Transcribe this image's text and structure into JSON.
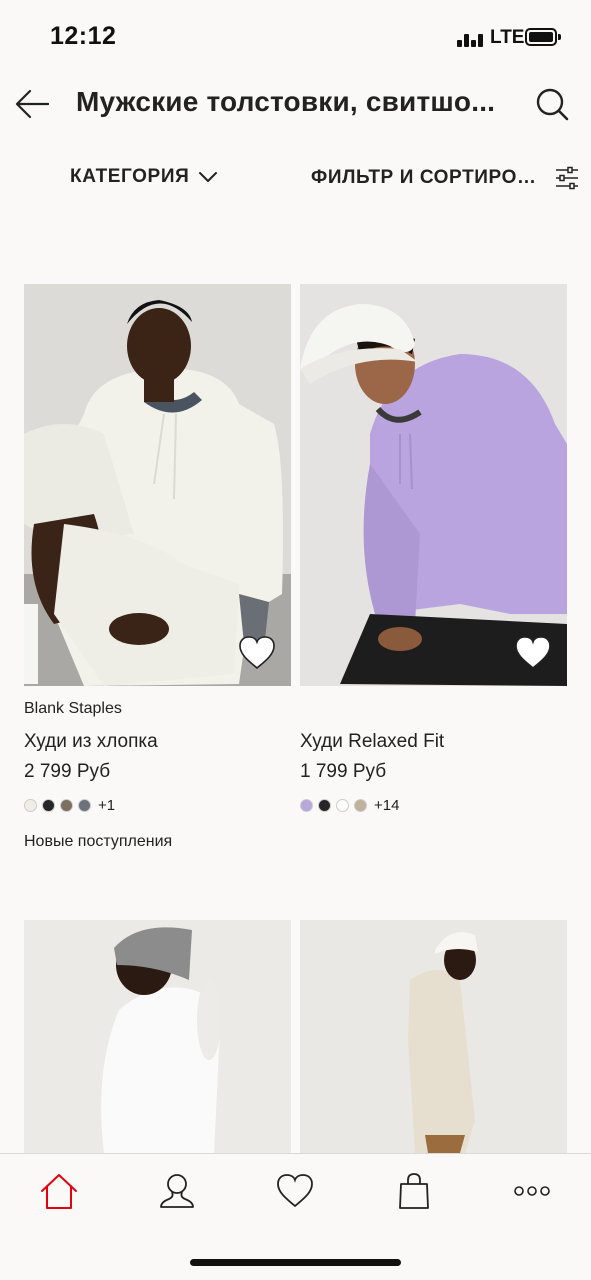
{
  "status_bar": {
    "time": "12:12",
    "carrier": "LTE"
  },
  "header": {
    "title": "Мужские толстовки, свитшо...",
    "back_icon": "arrow-left-icon",
    "search_icon": "search-icon"
  },
  "filters": {
    "category_label": "КАТЕГОРИЯ",
    "filter_label": "ФИЛЬТР И СОРТИРОВ...",
    "category_icon": "chevron-down-icon",
    "filter_icon": "sliders-icon"
  },
  "products": [
    {
      "brand": "Blank Staples",
      "name": "Худи из хлопка",
      "price": "2 799 Руб",
      "swatches": [
        "#efede6",
        "#262626",
        "#7d7060",
        "#6c717a"
      ],
      "more_colors": "+1",
      "tag": "Новые поступления"
    },
    {
      "brand": "",
      "name": "Худи Relaxed Fit",
      "price": "1 799 Руб",
      "swatches": [
        "#b7a7dc",
        "#262626",
        "#ffffff",
        "#bfb29b"
      ],
      "more_colors": "+14",
      "tag": ""
    }
  ],
  "bottom_nav": {
    "items": [
      "home-icon",
      "account-icon",
      "favorites-icon",
      "bag-icon",
      "more-icon"
    ],
    "active_color": "#e50010"
  }
}
